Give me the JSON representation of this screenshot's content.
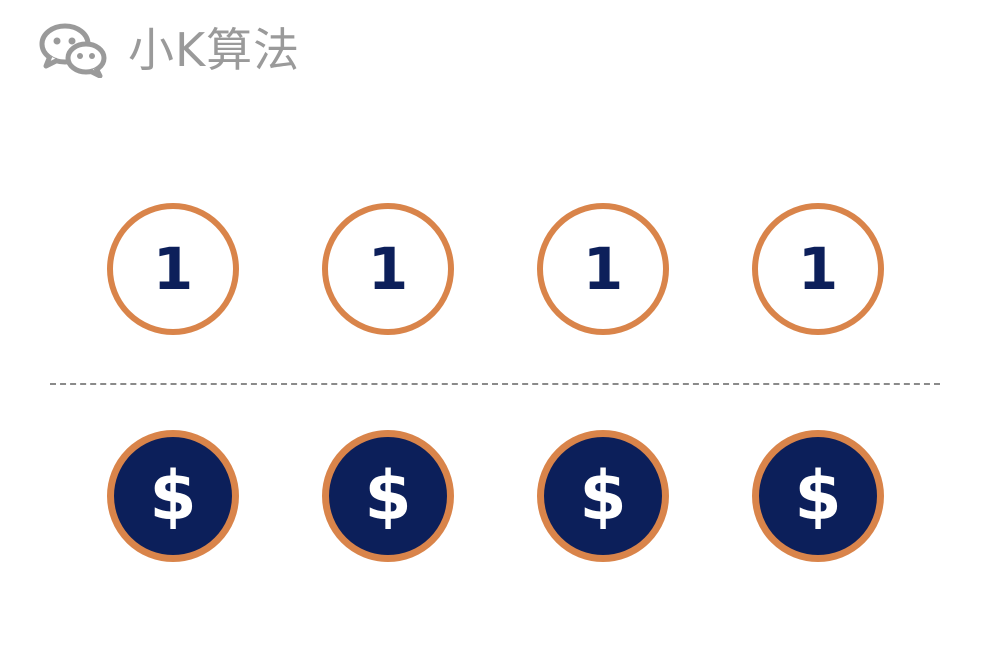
{
  "header": {
    "brand_icon": "wechat-icon",
    "brand_text": "小K算法"
  },
  "top_row": {
    "items": [
      {
        "label": "1"
      },
      {
        "label": "1"
      },
      {
        "label": "1"
      },
      {
        "label": "1"
      }
    ]
  },
  "bottom_row": {
    "items": [
      {
        "label": "$"
      },
      {
        "label": "$"
      },
      {
        "label": "$"
      },
      {
        "label": "$"
      }
    ]
  },
  "colors": {
    "ring": "#d9844a",
    "navy": "#0c1f5a",
    "brand_gray": "#9a9a9a",
    "divider": "#8a8a8a"
  }
}
